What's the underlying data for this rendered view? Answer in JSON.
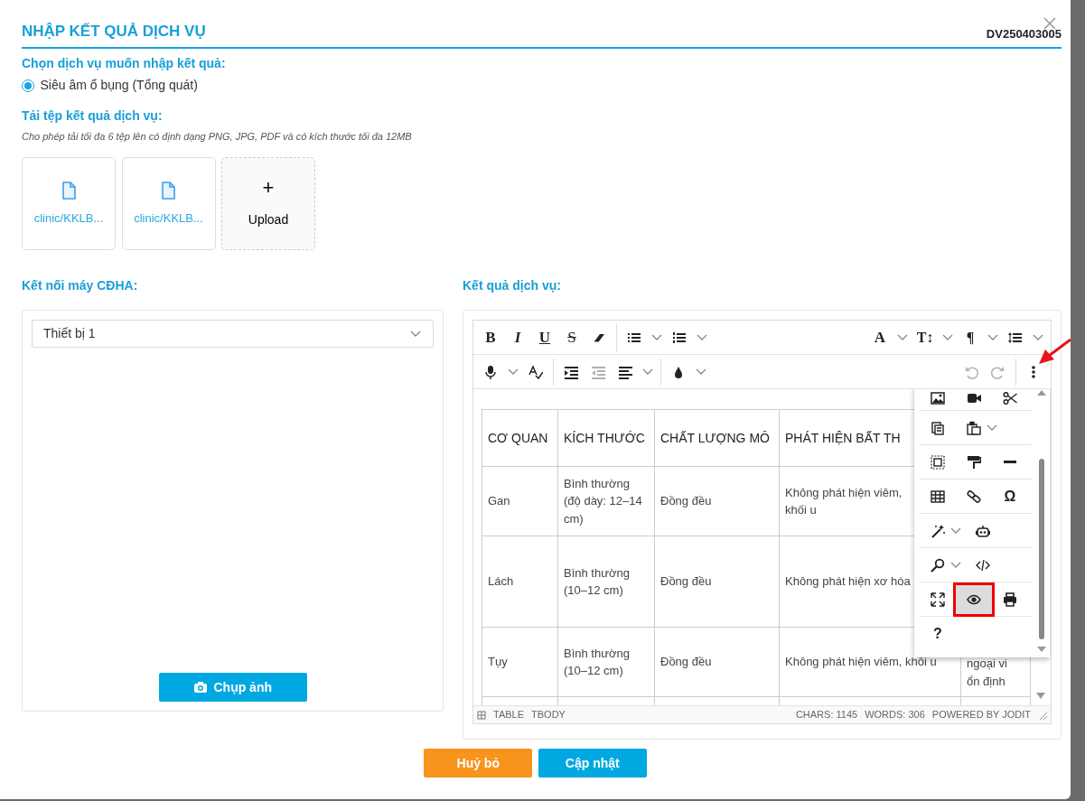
{
  "dialog": {
    "title": "NHẬP KẾT QUẢ DỊCH VỤ",
    "code": "DV250403005"
  },
  "service_section": {
    "label": "Chọn dịch vụ muốn nhập kết quả:",
    "options": [
      {
        "label": "Siêu âm ổ bụng (Tổng quát)",
        "selected": true
      }
    ]
  },
  "upload_section": {
    "label": "Tải tệp kết quả dịch vụ:",
    "hint": "Cho phép tải tối đa 6 tệp lên có định dạng PNG, JPG, PDF và có kích thước tối đa 12MB",
    "files": [
      {
        "name": "clinic/KKLB..."
      },
      {
        "name": "clinic/KKLB..."
      }
    ],
    "upload_label": "Upload",
    "upload_plus": "+"
  },
  "device_section": {
    "label": "Kết nối máy CĐHA:",
    "select": {
      "value": "Thiết bị 1"
    },
    "capture_button": "Chụp ảnh"
  },
  "result_section": {
    "label": "Kết quả dịch vụ:",
    "toolbar": [
      [
        {
          "kind": "bold",
          "glyph": "B",
          "disabled": false
        },
        {
          "kind": "italic",
          "glyph": "I",
          "disabled": false
        },
        {
          "kind": "underline",
          "glyph": "U",
          "disabled": false
        },
        {
          "kind": "strike",
          "glyph": "S",
          "disabled": false
        },
        {
          "kind": "eraser",
          "disabled": false
        },
        {
          "kind": "sep"
        },
        {
          "kind": "ul",
          "disabled": false
        },
        {
          "kind": "caret"
        },
        {
          "kind": "ol",
          "disabled": false
        },
        {
          "kind": "caret"
        },
        {
          "kind": "spacer"
        },
        {
          "kind": "font",
          "glyph": "A",
          "disabled": false
        },
        {
          "kind": "caret"
        },
        {
          "kind": "size",
          "glyph": "T↕",
          "disabled": false
        },
        {
          "kind": "caret"
        },
        {
          "kind": "paragraph",
          "glyph": "¶",
          "disabled": false
        },
        {
          "kind": "caret"
        },
        {
          "kind": "lineheight",
          "disabled": false
        },
        {
          "kind": "caret"
        }
      ],
      [
        {
          "kind": "mic",
          "disabled": false
        },
        {
          "kind": "caret"
        },
        {
          "kind": "spell",
          "disabled": false
        },
        {
          "kind": "sep"
        },
        {
          "kind": "indent",
          "disabled": false
        },
        {
          "kind": "outdent",
          "disabled": true
        },
        {
          "kind": "align",
          "disabled": false
        },
        {
          "kind": "caret"
        },
        {
          "kind": "sep"
        },
        {
          "kind": "color",
          "disabled": false
        },
        {
          "kind": "caret"
        },
        {
          "kind": "spacer"
        },
        {
          "kind": "undo",
          "disabled": true
        },
        {
          "kind": "redo",
          "disabled": true
        },
        {
          "kind": "sep"
        },
        {
          "kind": "dots",
          "disabled": false
        }
      ]
    ],
    "table": {
      "header": [
        "CƠ QUAN",
        "KÍCH THƯỚC",
        "CHẤT LƯỢNG MÔ",
        "PHÁT HIỆN BẤT TH"
      ],
      "rows": [
        [
          "Gan",
          "Bình thường (độ dày: 12–14 cm)",
          "Đồng đều",
          "Không phát hiện viêm,\nkhối u"
        ],
        [
          "Lách",
          "Bình thường (10–12 cm)",
          "Đồng đều",
          "Không phát hiện xơ hóa"
        ],
        [
          "Tụy",
          "Bình thường (10–12 cm)",
          "Đồng đều",
          "Không phát hiện viêm, khối u",
          "ngoại vi\nổn định"
        ]
      ]
    },
    "more_menu": [
      [
        {
          "kind": "image",
          "highlighted": false
        },
        {
          "kind": "video",
          "highlighted": false
        },
        {
          "kind": "cut",
          "highlighted": false
        }
      ],
      [
        {
          "kind": "copy",
          "highlighted": false
        },
        {
          "kind": "paste",
          "highlighted": false
        },
        {
          "kind": "caret"
        }
      ],
      [
        {
          "kind": "selectall",
          "highlighted": false
        },
        {
          "kind": "painter",
          "highlighted": false
        },
        {
          "kind": "hr",
          "highlighted": false
        }
      ],
      [
        {
          "kind": "table",
          "highlighted": false
        },
        {
          "kind": "link",
          "highlighted": false
        },
        {
          "kind": "symbol",
          "glyph": "Ω",
          "highlighted": false
        }
      ],
      [
        {
          "kind": "magic",
          "highlighted": false
        },
        {
          "kind": "caret"
        },
        {
          "kind": "robot",
          "highlighted": false
        }
      ],
      [
        {
          "kind": "find",
          "highlighted": false
        },
        {
          "kind": "caret"
        },
        {
          "kind": "source",
          "highlighted": false
        }
      ],
      [
        {
          "kind": "fullsize",
          "highlighted": false
        },
        {
          "kind": "preview",
          "highlighted": true
        },
        {
          "kind": "print",
          "highlighted": false
        }
      ],
      [
        {
          "kind": "help",
          "glyph": "?",
          "highlighted": false
        }
      ]
    ],
    "status_bar": {
      "path": [
        "TABLE",
        "TBODY"
      ],
      "chars": "CHARS: 1145",
      "words": "WORDS: 306",
      "powered": "POWERED BY JODIT"
    }
  },
  "footer": {
    "buttons": [
      {
        "label": "Huỷ bỏ",
        "kind": "cancel"
      },
      {
        "label": "Cập nhật",
        "kind": "primary"
      }
    ]
  }
}
